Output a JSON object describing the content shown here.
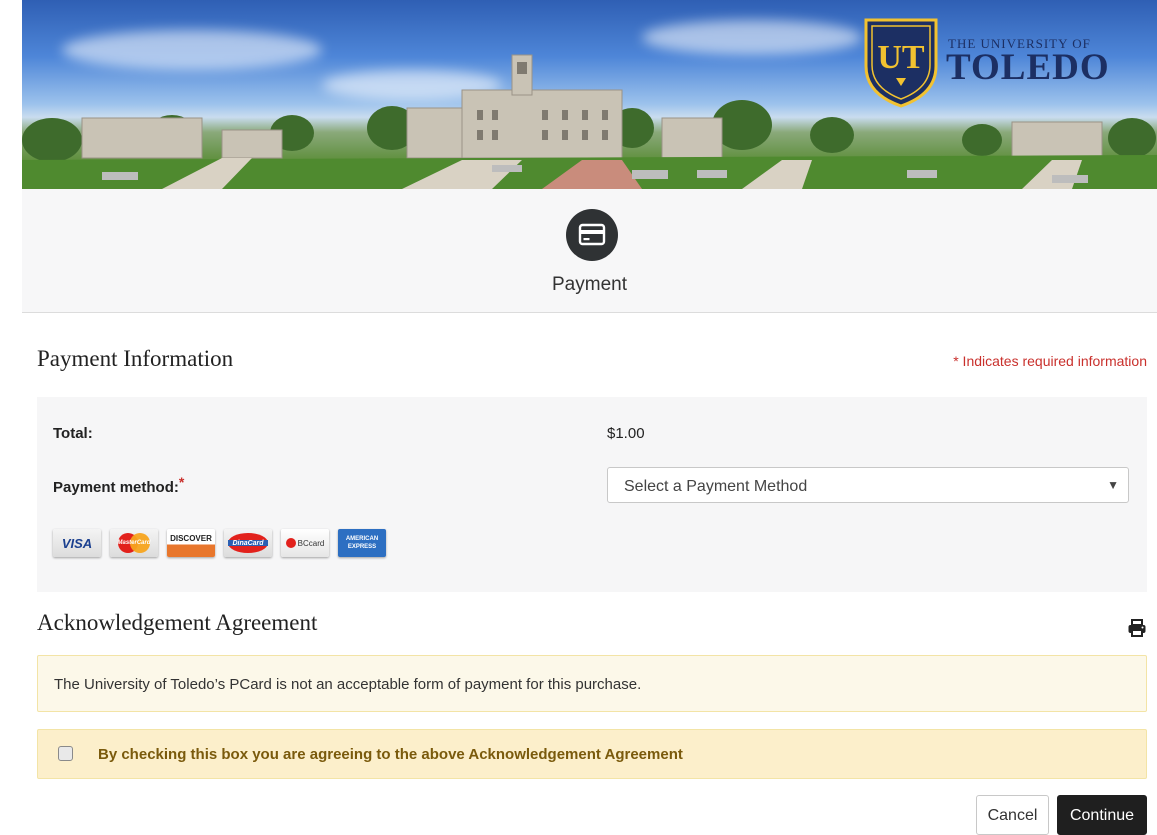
{
  "banner": {
    "logo_monogram": "UT",
    "logo_line1": "THE UNIVERSITY OF",
    "logo_line2": "TOLEDO"
  },
  "step": {
    "icon": "credit-card-icon",
    "label": "Payment"
  },
  "payment_info": {
    "title": "Payment Information",
    "required_note": "* Indicates required information",
    "total_label": "Total:",
    "total_value": "$1.00",
    "method_label": "Payment method:",
    "method_required_mark": "*",
    "method_select_value": "Select a Payment Method",
    "cards": [
      {
        "name": "VISA"
      },
      {
        "name": "MasterCard"
      },
      {
        "name": "DISCOVER"
      },
      {
        "name": "DinaCard"
      },
      {
        "name": "BCcard"
      },
      {
        "name": "AMERICAN EXPRESS"
      }
    ]
  },
  "acknowledgement": {
    "title": "Acknowledgement Agreement",
    "print_icon": "print-icon",
    "text": "The University of Toledo’s PCard is not an acceptable form of payment for this purchase.",
    "checkbox_label": "By checking this box you are agreeing to the above Acknowledgement Agreement",
    "checkbox_checked": false
  },
  "actions": {
    "cancel_label": "Cancel",
    "continue_label": "Continue"
  },
  "colors": {
    "brand_navy": "#1c2f63",
    "brand_gold": "#f2c230",
    "required_red": "#c9302c",
    "continue_bg": "#1f1f1f"
  }
}
